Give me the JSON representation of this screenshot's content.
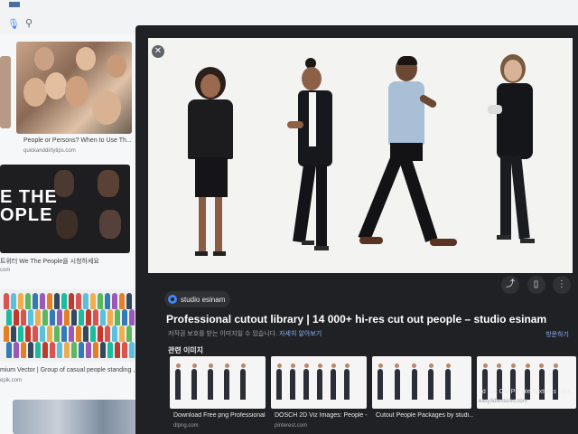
{
  "left": {
    "results": [
      {
        "caption": "People or Persons? When to Use Th...",
        "source": "quickanddirtytips.com"
      },
      {
        "banner": "E THE\nOPLE",
        "caption": "트위터 We The People을 시청하세요",
        "source": "com"
      },
      {
        "caption": "mium Vector | Group of casual people standing , big",
        "source": "epik.com"
      }
    ]
  },
  "preview": {
    "close_icon": "close-icon",
    "actions": [
      {
        "icon": "share-icon",
        "glyph": "⤴"
      },
      {
        "icon": "bookmark-icon",
        "glyph": "▯"
      },
      {
        "icon": "more-vert-icon",
        "glyph": "⋮"
      }
    ],
    "source_name": "studio esinam",
    "title": "Professional cutout library | 14 000+ hi-res cut out people – studio esinam",
    "notice": "저작권 보호를 받는 이미지일 수 있습니다.",
    "notice_link": "자세히 알아보기",
    "visit": "방문하기",
    "related_heading": "관련 이미지"
  },
  "related": [
    {
      "caption": "Download Free png Professional ...",
      "source": "dlpng.com"
    },
    {
      "caption": "DOSCH 2D Viz Images: People - ...",
      "source": "pinterest.com"
    },
    {
      "caption": "Cutout People Packages by studi...",
      "source": ""
    },
    {
      "caption": "2d Cut Out People Textures | Bu...",
      "source": "easy3dtextures.com"
    }
  ],
  "colors": {
    "panel_bg": "#202124",
    "accent": "#8ab4f8",
    "source_logo": "#4285f4"
  }
}
